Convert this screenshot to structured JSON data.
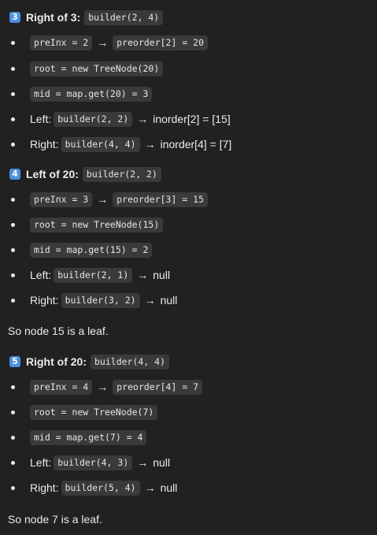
{
  "sections": [
    {
      "badge": "3",
      "heading": "Right of 3:",
      "heading_code": "builder(2, 4)",
      "bullets": [
        {
          "codeA": "preInx = 2",
          "arrow": "→",
          "codeB": "preorder[2] = 20"
        },
        {
          "code": "root = new TreeNode(20)"
        },
        {
          "code": "mid = map.get(20) = 3"
        },
        {
          "label": "Left:",
          "code": "builder(2, 2)",
          "arrow": "→",
          "text": "inorder[2] = [15]"
        },
        {
          "label": "Right:",
          "code": "builder(4, 4)",
          "arrow": "→",
          "text": "inorder[4] = [7]"
        }
      ]
    },
    {
      "badge": "4",
      "heading": "Left of 20:",
      "heading_code": "builder(2, 2)",
      "bullets": [
        {
          "codeA": "preInx = 3",
          "arrow": "→",
          "codeB": "preorder[3] = 15"
        },
        {
          "code": "root = new TreeNode(15)"
        },
        {
          "code": "mid = map.get(15) = 2"
        },
        {
          "label": "Left:",
          "code": "builder(2, 1)",
          "arrow": "→",
          "text": "null"
        },
        {
          "label": "Right:",
          "code": "builder(3, 2)",
          "arrow": "→",
          "text": "null"
        }
      ],
      "after": "So node 15 is a leaf."
    },
    {
      "badge": "5",
      "heading": "Right of 20:",
      "heading_code": "builder(4, 4)",
      "bullets": [
        {
          "codeA": "preInx = 4",
          "arrow": "→",
          "codeB": "preorder[4] = 7"
        },
        {
          "code": "root = new TreeNode(7)"
        },
        {
          "code": "mid = map.get(7) = 4"
        },
        {
          "label": "Left:",
          "code": "builder(4, 3)",
          "arrow": "→",
          "text": "null"
        },
        {
          "label": "Right:",
          "code": "builder(5, 4)",
          "arrow": "→",
          "text": "null"
        }
      ],
      "after": "So node 7 is a leaf."
    }
  ],
  "colors": {
    "background": "#212121",
    "text": "#ececec",
    "code_bg": "#3a3a3a",
    "badge": "#4a8fe0"
  }
}
